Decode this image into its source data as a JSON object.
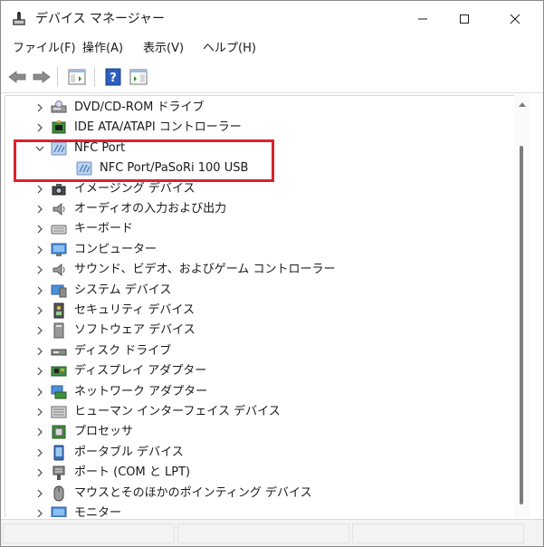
{
  "window": {
    "title": "デバイス マネージャー"
  },
  "menu": [
    {
      "label": "ファイル(F)",
      "id": "file"
    },
    {
      "label": "操作(A)",
      "id": "action"
    },
    {
      "label": "表示(V)",
      "id": "view"
    },
    {
      "label": "ヘルプ(H)",
      "id": "help"
    }
  ],
  "toolbar": {
    "back": "back-arrow-icon",
    "forward": "forward-arrow-icon",
    "properties": "properties-icon",
    "help": "help-icon",
    "show": "console-tree-icon"
  },
  "tree": [
    {
      "label": "DVD/CD-ROM ドライブ",
      "icon": "dvd-drive-icon",
      "state": "collapsed",
      "level": 0
    },
    {
      "label": "IDE ATA/ATAPI コントローラー",
      "icon": "ide-controller-icon",
      "state": "collapsed",
      "level": 0
    },
    {
      "label": "NFC Port",
      "icon": "nfc-icon",
      "state": "expanded",
      "level": 0
    },
    {
      "label": "NFC Port/PaSoRi 100 USB",
      "icon": "nfc-icon",
      "state": "leaf",
      "level": 1
    },
    {
      "label": "イメージング デバイス",
      "icon": "camera-icon",
      "state": "collapsed",
      "level": 0
    },
    {
      "label": "オーディオの入力および出力",
      "icon": "speaker-icon",
      "state": "collapsed",
      "level": 0
    },
    {
      "label": "キーボード",
      "icon": "keyboard-icon",
      "state": "collapsed",
      "level": 0
    },
    {
      "label": "コンピューター",
      "icon": "monitor-icon",
      "state": "collapsed",
      "level": 0
    },
    {
      "label": "サウンド、ビデオ、およびゲーム コントローラー",
      "icon": "speaker-icon",
      "state": "collapsed",
      "level": 0
    },
    {
      "label": "システム デバイス",
      "icon": "system-device-icon",
      "state": "collapsed",
      "level": 0
    },
    {
      "label": "セキュリティ デバイス",
      "icon": "security-device-icon",
      "state": "collapsed",
      "level": 0
    },
    {
      "label": "ソフトウェア デバイス",
      "icon": "software-device-icon",
      "state": "collapsed",
      "level": 0
    },
    {
      "label": "ディスク ドライブ",
      "icon": "disk-drive-icon",
      "state": "collapsed",
      "level": 0
    },
    {
      "label": "ディスプレイ アダプター",
      "icon": "display-adapter-icon",
      "state": "collapsed",
      "level": 0
    },
    {
      "label": "ネットワーク アダプター",
      "icon": "network-adapter-icon",
      "state": "collapsed",
      "level": 0
    },
    {
      "label": "ヒューマン インターフェイス デバイス",
      "icon": "hid-icon",
      "state": "collapsed",
      "level": 0
    },
    {
      "label": "プロセッサ",
      "icon": "processor-icon",
      "state": "collapsed",
      "level": 0
    },
    {
      "label": "ポータブル デバイス",
      "icon": "portable-device-icon",
      "state": "collapsed",
      "level": 0
    },
    {
      "label": "ポート (COM と LPT)",
      "icon": "port-icon",
      "state": "collapsed",
      "level": 0
    },
    {
      "label": "マウスとそのほかのポインティング デバイス",
      "icon": "mouse-icon",
      "state": "collapsed",
      "level": 0
    },
    {
      "label": "モニター",
      "icon": "monitor-icon",
      "state": "collapsed",
      "level": 0
    }
  ],
  "colors": {
    "highlight": "#d9232e",
    "accent": "#3c78c8"
  }
}
